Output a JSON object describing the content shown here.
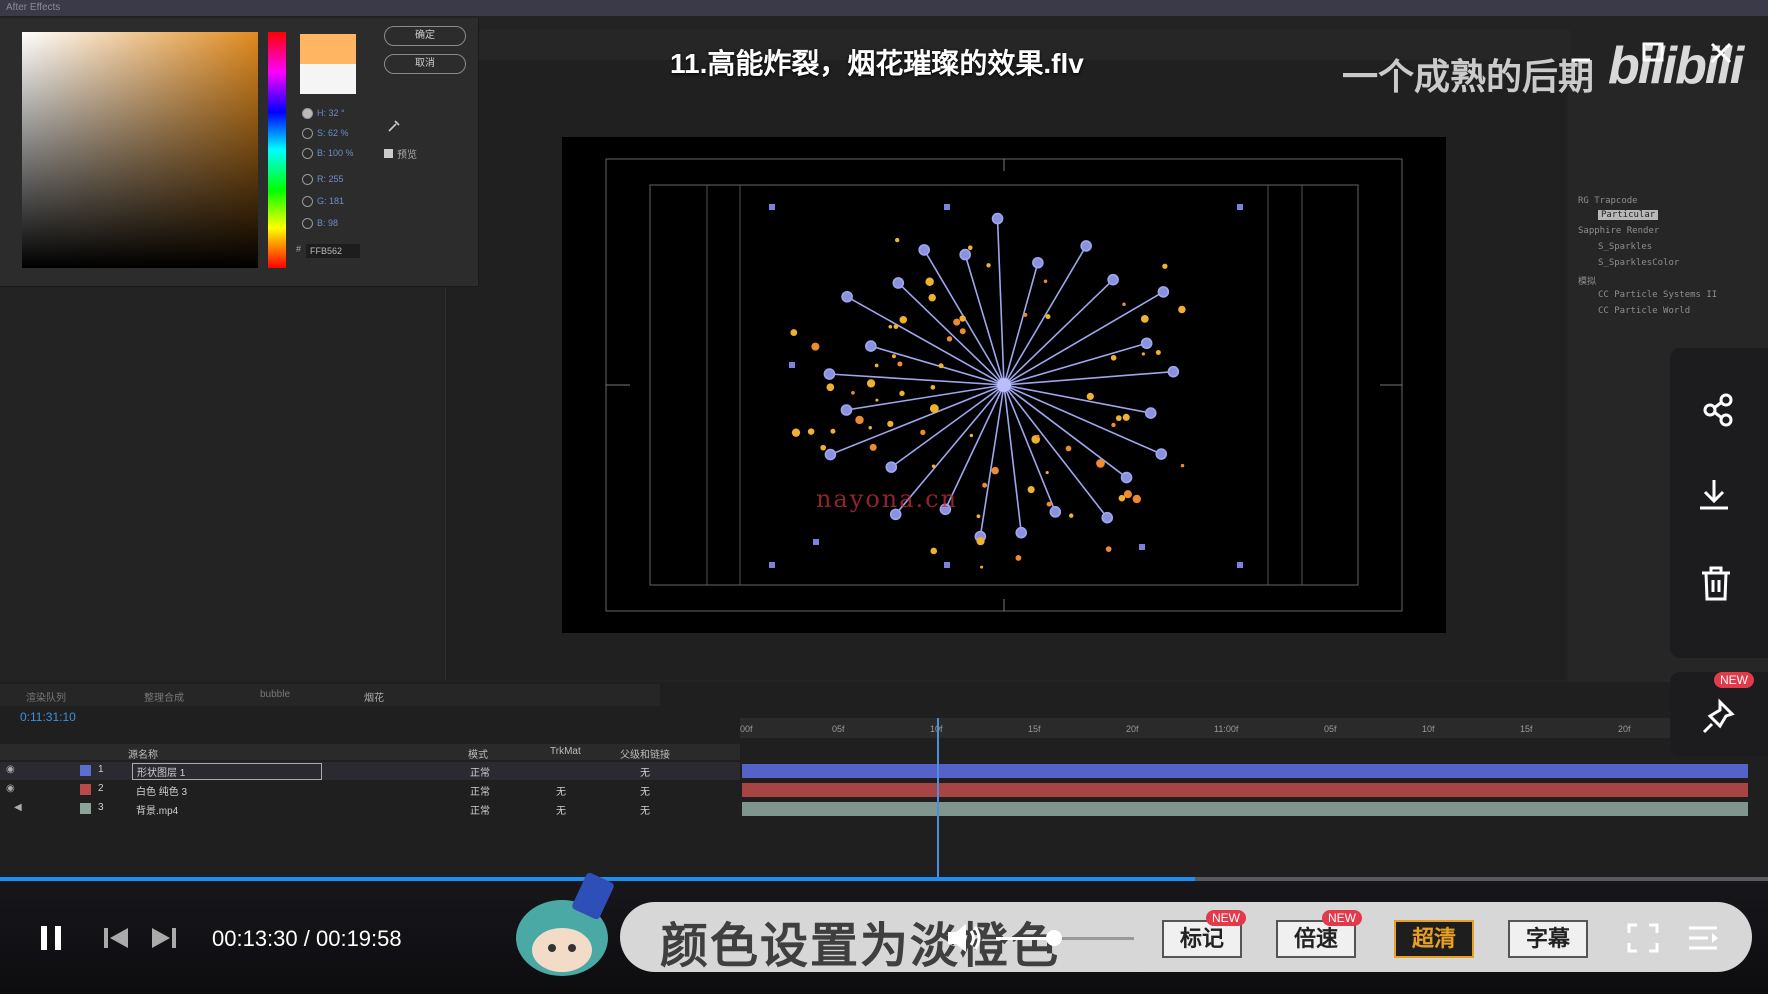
{
  "window": {
    "title": "11.高能炸裂，烟花璀璨的效果.flv",
    "channel_watermark": "一个成熟的后期",
    "brand_logo": "bilibili",
    "controls_icons": [
      "minimize-icon",
      "maximize-icon",
      "close-icon"
    ]
  },
  "ae": {
    "app_title": "After Effects",
    "color_picker": {
      "ok_label": "确定",
      "cancel_label": "取消",
      "rows": [
        {
          "label": "H",
          "value": "32 °"
        },
        {
          "label": "S",
          "value": "62 %"
        },
        {
          "label": "B",
          "value": "100 %"
        },
        {
          "label": "R",
          "value": "255"
        },
        {
          "label": "G",
          "value": "181"
        },
        {
          "label": "B",
          "value": "98"
        }
      ],
      "hex_prefix": "#",
      "hex": "FFB562",
      "checkbox_label": "预览",
      "selected_color": "#ffb562",
      "old_color": "#f5f5f5"
    },
    "effects_panel": {
      "items": [
        "RG Trapcode",
        "Particular",
        "Sapphire Render",
        "S_Sparkles",
        "S_SparklesColor",
        "模拟",
        "CC Particle Systems II",
        "CC Particle World"
      ]
    },
    "timeline": {
      "tabs": [
        "渲染队列",
        "整理合成",
        "bubble",
        "烟花"
      ],
      "timecode": "0:11:31:10",
      "ruler_labels": [
        "00f",
        "05f",
        "10f",
        "15f",
        "20f",
        "11:00f",
        "05f",
        "10f",
        "15f",
        "20f"
      ],
      "columns": {
        "name": "源名称",
        "mode": "模式",
        "trkmat": "TrkMat",
        "parent": "父级和链接"
      },
      "layers": [
        {
          "index": "1",
          "name": "形状图层 1",
          "mode": "正常",
          "trkmat": "",
          "parent": "无",
          "color": "#5b6fcf"
        },
        {
          "index": "2",
          "name": "白色 纯色 3",
          "mode": "正常",
          "trkmat": "无",
          "parent": "无",
          "color": "#b84a4a"
        },
        {
          "index": "3",
          "name": "背景.mp4",
          "mode": "正常",
          "trkmat": "无",
          "parent": "无",
          "color": "#8aa49a"
        }
      ]
    }
  },
  "overlay": {
    "watermark": "nayona.cn",
    "subtitle": "颜色设置为淡橙色"
  },
  "player": {
    "current_time": "00:13:30",
    "total_time": "00:19:58",
    "time_separator": " / ",
    "progress_fraction": 0.676,
    "volume_fraction": 0.42,
    "buttons": {
      "mark_label": "标记",
      "speed_label": "倍速",
      "quality_label": "超清",
      "subtitle_label": "字幕",
      "new_badge": "NEW"
    },
    "side_icons": [
      "share-icon",
      "download-icon",
      "delete-icon",
      "pin-icon"
    ],
    "accent_color": "#1e8ef0",
    "quality_active_color": "#e8a020"
  }
}
